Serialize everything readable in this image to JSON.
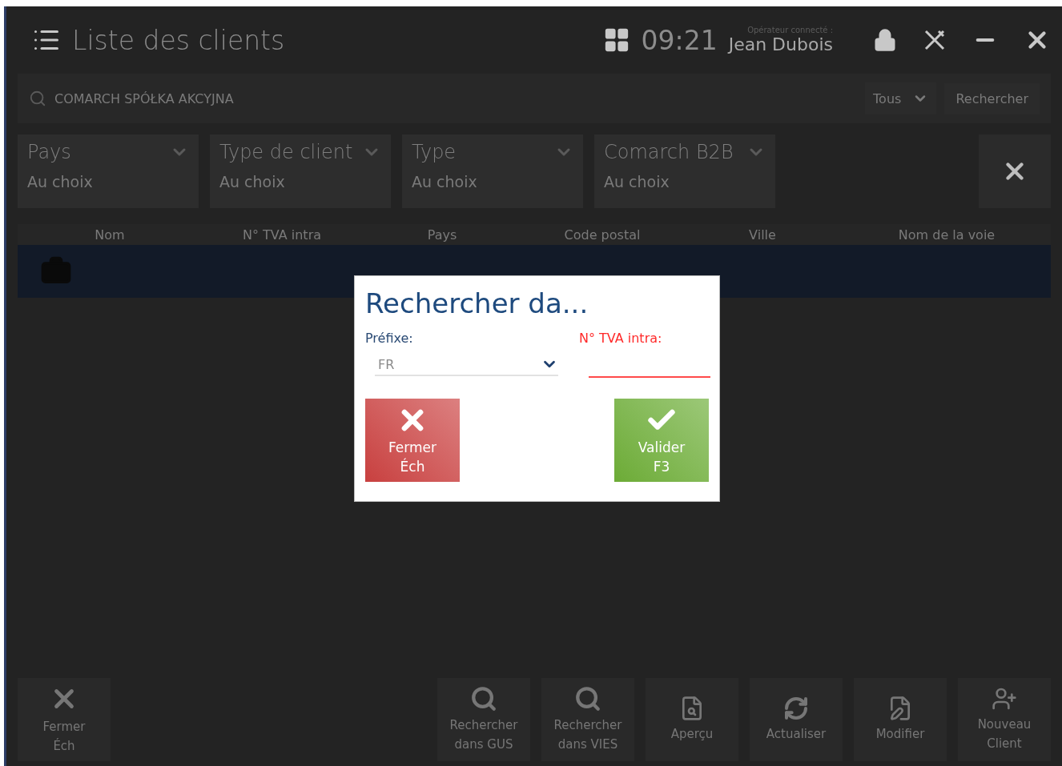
{
  "window": {
    "title": "Liste des clients",
    "time": "09:21",
    "operator_label": "Opérateur connecté :",
    "operator": "Jean Dubois"
  },
  "search": {
    "value": "COMARCH SPÓŁKA AKCYJNA",
    "scope": "Tous",
    "button": "Rechercher"
  },
  "filters": [
    {
      "label": "Pays",
      "value": "Au choix"
    },
    {
      "label": "Type de client",
      "value": "Au choix"
    },
    {
      "label": "Type",
      "value": "Au choix"
    },
    {
      "label": "Comarch B2B",
      "value": "Au choix"
    }
  ],
  "table": {
    "columns": [
      "Nom",
      "N° TVA intra",
      "Pays",
      "Code postal",
      "Ville",
      "Nom de la voie"
    ],
    "rows": [
      {
        "selected": true
      }
    ]
  },
  "dialog": {
    "title": "Rechercher da...",
    "prefix_label": "Préfixe:",
    "prefix_value": "FR",
    "vat_label": "N° TVA intra:",
    "buttons": [
      {
        "kind": "cancel",
        "label": "Fermer",
        "shortcut": "Éch"
      },
      {
        "kind": "confirm",
        "label": "Valider",
        "shortcut": "F3"
      }
    ]
  },
  "toolbar": [
    {
      "kind": "close",
      "lines": [
        "Fermer",
        "Éch"
      ]
    },
    {
      "kind": "spacer"
    },
    {
      "kind": "search",
      "lines": [
        "Rechercher",
        "dans GUS"
      ]
    },
    {
      "kind": "search",
      "lines": [
        "Rechercher",
        "dans VIES"
      ]
    },
    {
      "kind": "preview",
      "lines": [
        "Aperçu"
      ]
    },
    {
      "kind": "refresh",
      "lines": [
        "Actualiser"
      ]
    },
    {
      "kind": "edit",
      "lines": [
        "Modifier"
      ]
    },
    {
      "kind": "new-client",
      "lines": [
        "Nouveau",
        "Client"
      ]
    }
  ]
}
